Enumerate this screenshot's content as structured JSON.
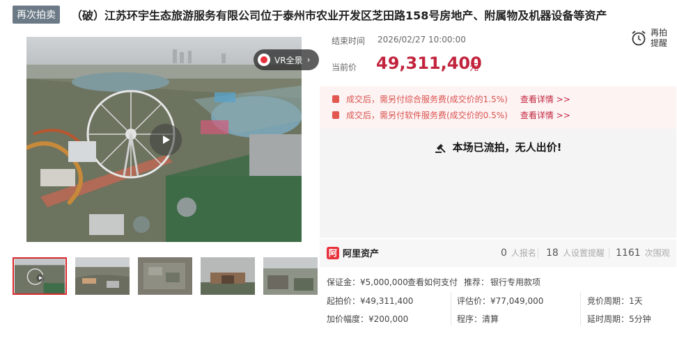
{
  "header": {
    "tag": "再次拍卖",
    "title": "（破）江苏环宇生态旅游服务有限公司位于泰州市农业开发区芝田路158号房地产、附属物及机器设备等资产"
  },
  "gallery": {
    "vr_label": "VR全景",
    "vr_arrow": "›",
    "thumbnail_count": 5,
    "active_thumbnail": 1
  },
  "auction": {
    "end_label": "结束时间",
    "end_time": "2026/02/27 10:00:00",
    "current_label": "当前价",
    "current_price": "49,311,400",
    "price_unit": "元",
    "remind_label": "再拍提醒"
  },
  "fees": [
    {
      "text": "成交后，需另付综合服务费(成交价的1.5%)",
      "link": "查看详情 >>"
    },
    {
      "text": "成交后，需另付软件服务费(成交价的0.5%)",
      "link": "查看详情 >>"
    }
  ],
  "status": {
    "message": "本场已流拍，无人出价!"
  },
  "platform": {
    "name": "阿里资产",
    "stats": [
      {
        "count": "0",
        "label": "人报名"
      },
      {
        "count": "18",
        "label": "人设置提醒"
      },
      {
        "count": "1161",
        "label": "次围观"
      }
    ]
  },
  "details": {
    "deposit": "保证金：¥5,000,000",
    "pay_link": "查看如何支付",
    "recommend_label": "推荐：",
    "recommend_link": "银行专用款项",
    "start_price": "起拍价：¥49,311,400",
    "appraisal": "评估价：¥77,049,000",
    "cycle": "竞价周期：1天",
    "increment": "加价幅度：¥200,000",
    "procedure": "程序：清算",
    "delay": "延时周期：5分钟"
  },
  "colors": {
    "price": "#c2243d",
    "tag_bg": "#6b7a86",
    "link": "#3a6fb8",
    "brand": "#e8323d"
  }
}
